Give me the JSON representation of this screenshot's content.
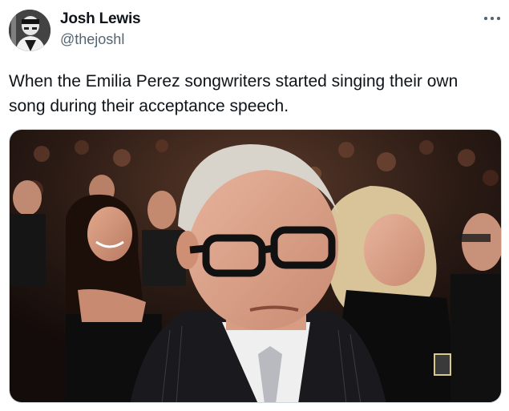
{
  "author": {
    "display_name": "Josh Lewis",
    "handle": "@thejoshl"
  },
  "tweet": {
    "text": "When the Emilia Perez songwriters started singing their own song during their acceptance speech."
  },
  "icons": {
    "more": "more-horizontal-icon"
  }
}
